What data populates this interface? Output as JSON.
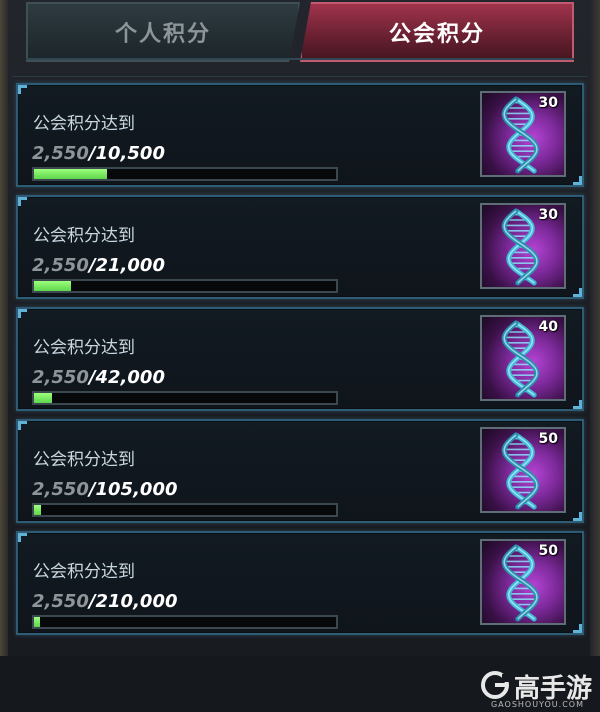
{
  "tabs": {
    "personal": "个人积分",
    "guild": "公会积分"
  },
  "rows": [
    {
      "title": "公会积分达到",
      "current": "2,550",
      "target": "/10,500",
      "progress": 0.243,
      "reward_count": "30",
      "reward_icon": "dna-icon"
    },
    {
      "title": "公会积分达到",
      "current": "2,550",
      "target": "/21,000",
      "progress": 0.121,
      "reward_count": "30",
      "reward_icon": "dna-icon"
    },
    {
      "title": "公会积分达到",
      "current": "2,550",
      "target": "/42,000",
      "progress": 0.061,
      "reward_count": "40",
      "reward_icon": "dna-icon"
    },
    {
      "title": "公会积分达到",
      "current": "2,550",
      "target": "/105,000",
      "progress": 0.024,
      "reward_count": "50",
      "reward_icon": "dna-icon"
    },
    {
      "title": "公会积分达到",
      "current": "2,550",
      "target": "/210,000",
      "progress": 0.012,
      "reward_count": "50",
      "reward_icon": "dna-icon"
    }
  ],
  "watermark": {
    "brand": "高手游",
    "url": "GAOSHOUYOU.COM"
  },
  "colors": {
    "progress_fill": "#7ff060",
    "active_tab": "#8f2a42",
    "row_border": "#2f5c75"
  }
}
